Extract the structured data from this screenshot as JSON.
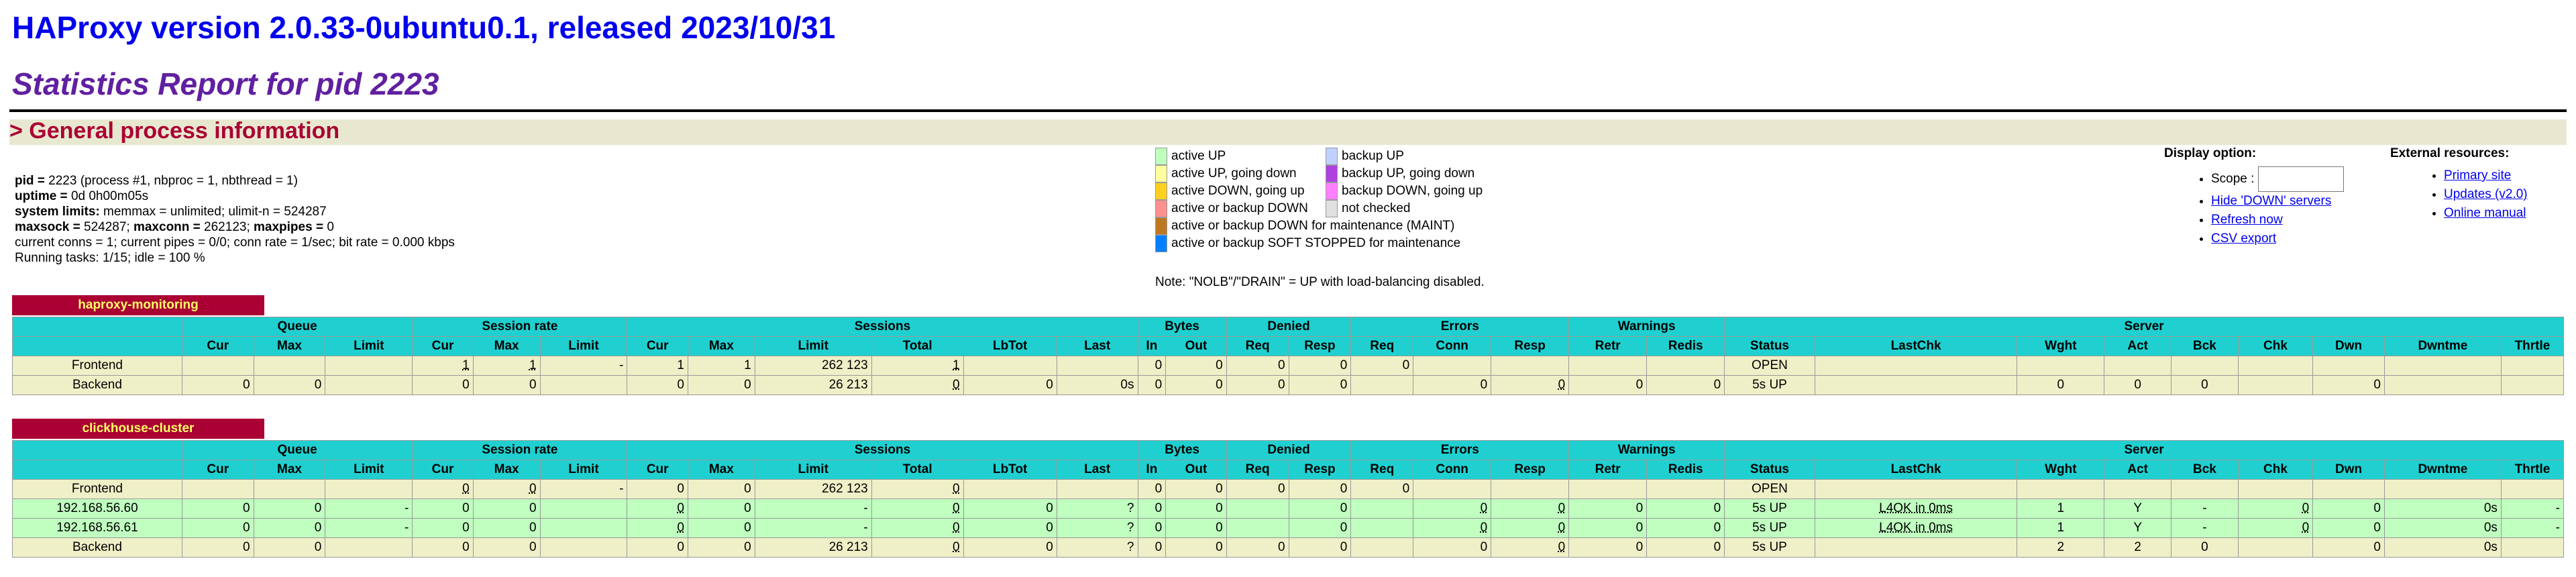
{
  "header": {
    "title": "HAProxy version 2.0.33-0ubuntu0.1, released 2023/10/31",
    "subtitle": "Statistics Report for pid 2223",
    "section": "> General process information"
  },
  "process_info": {
    "pid_label": "pid = ",
    "pid_value": "2223 (process #1, nbproc = 1, nbthread = 1)",
    "uptime_label": "uptime = ",
    "uptime_value": "0d 0h00m05s",
    "limits_label": "system limits:",
    "limits_value": " memmax = unlimited; ulimit-n = 524287",
    "maxsock_label": "maxsock = ",
    "maxsock_value": "524287; ",
    "maxconn_label": "maxconn = ",
    "maxconn_value": "262123; ",
    "maxpipes_label": "maxpipes = ",
    "maxpipes_value": "0",
    "conns_line": "current conns = 1; current pipes = 0/0; conn rate = 1/sec; bit rate = 0.000 kbps",
    "tasks_line": "Running tasks: 1/15; idle = 100 %"
  },
  "legend": {
    "items": [
      {
        "label": "active UP",
        "color": "#c0ffc0"
      },
      {
        "label": "active UP, going down",
        "color": "#ffffa0"
      },
      {
        "label": "active DOWN, going up",
        "color": "#ffd020"
      },
      {
        "label": "active or backup DOWN",
        "color": "#ff9090"
      },
      {
        "label": "active or backup DOWN for maintenance (MAINT)",
        "color": "#c07820"
      },
      {
        "label": "active or backup SOFT STOPPED for maintenance",
        "color": "#0080ff"
      },
      {
        "label": "backup UP",
        "color": "#c0d0ff"
      },
      {
        "label": "backup UP, going down",
        "color": "#b040e0"
      },
      {
        "label": "backup DOWN, going up",
        "color": "#ff80ff"
      },
      {
        "label": "not checked",
        "color": "#e0e0e0"
      }
    ],
    "note": "Note: \"NOLB\"/\"DRAIN\" = UP with load-balancing disabled."
  },
  "display_options": {
    "title": "Display option:",
    "scope_label": "Scope : ",
    "scope_value": "",
    "links": [
      "Hide 'DOWN' servers",
      "Refresh now",
      "CSV export"
    ]
  },
  "external_resources": {
    "title": "External resources:",
    "links": [
      "Primary site",
      "Updates (v2.0)",
      "Online manual"
    ]
  },
  "column_groups": [
    "",
    "Queue",
    "Session rate",
    "Sessions",
    "Bytes",
    "Denied",
    "Errors",
    "Warnings",
    "Server"
  ],
  "columns": [
    "",
    "Cur",
    "Max",
    "Limit",
    "Cur",
    "Max",
    "Limit",
    "Cur",
    "Max",
    "Limit",
    "Total",
    "LbTot",
    "Last",
    "In",
    "Out",
    "Req",
    "Resp",
    "Req",
    "Conn",
    "Resp",
    "Retr",
    "Redis",
    "Status",
    "LastChk",
    "Wght",
    "Act",
    "Bck",
    "Chk",
    "Dwn",
    "Dwntme",
    "Thrtle"
  ],
  "proxies": [
    {
      "name": "haproxy-monitoring",
      "rows": [
        {
          "kind": "fe",
          "cells": [
            "Frontend",
            "",
            "",
            "",
            "1",
            "1",
            "-",
            "1",
            "1",
            "262 123",
            "1",
            "",
            "",
            "0",
            "0",
            "0",
            "0",
            "0",
            "",
            "",
            "",
            "",
            "OPEN",
            "",
            "",
            "",
            "",
            "",
            "",
            "",
            ""
          ]
        },
        {
          "kind": "be",
          "cells": [
            "Backend",
            "0",
            "0",
            "",
            "0",
            "0",
            "",
            "0",
            "0",
            "26 213",
            "0",
            "0",
            "0s",
            "0",
            "0",
            "0",
            "0",
            "",
            "0",
            "0",
            "0",
            "0",
            "5s UP",
            "",
            "0",
            "0",
            "0",
            "",
            "0",
            "",
            ""
          ]
        }
      ]
    },
    {
      "name": "clickhouse-cluster",
      "rows": [
        {
          "kind": "fe",
          "cells": [
            "Frontend",
            "",
            "",
            "",
            "0",
            "0",
            "-",
            "0",
            "0",
            "262 123",
            "0",
            "",
            "",
            "0",
            "0",
            "0",
            "0",
            "0",
            "",
            "",
            "",
            "",
            "OPEN",
            "",
            "",
            "",
            "",
            "",
            "",
            "",
            ""
          ]
        },
        {
          "kind": "sv",
          "cells": [
            "192.168.56.60",
            "0",
            "0",
            "-",
            "0",
            "0",
            "",
            "0",
            "0",
            "-",
            "0",
            "0",
            "?",
            "0",
            "0",
            "",
            "0",
            "",
            "0",
            "0",
            "0",
            "0",
            "5s UP",
            "L4OK in 0ms",
            "1",
            "Y",
            "-",
            "0",
            "0",
            "0s",
            "-"
          ]
        },
        {
          "kind": "sv",
          "cells": [
            "192.168.56.61",
            "0",
            "0",
            "-",
            "0",
            "0",
            "",
            "0",
            "0",
            "-",
            "0",
            "0",
            "?",
            "0",
            "0",
            "",
            "0",
            "",
            "0",
            "0",
            "0",
            "0",
            "5s UP",
            "L4OK in 0ms",
            "1",
            "Y",
            "-",
            "0",
            "0",
            "0s",
            "-"
          ]
        },
        {
          "kind": "be",
          "cells": [
            "Backend",
            "0",
            "0",
            "",
            "0",
            "0",
            "",
            "0",
            "0",
            "26 213",
            "0",
            "0",
            "?",
            "0",
            "0",
            "0",
            "0",
            "",
            "0",
            "0",
            "0",
            "0",
            "5s UP",
            "",
            "2",
            "2",
            "0",
            "",
            "0",
            "0s",
            ""
          ]
        }
      ]
    }
  ]
}
